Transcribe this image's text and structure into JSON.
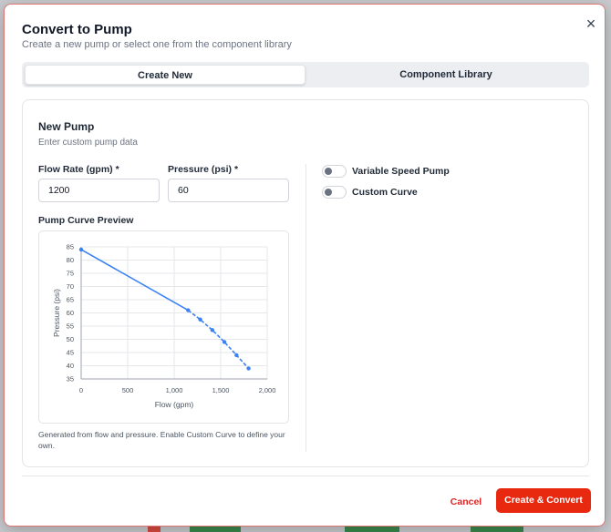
{
  "dialog": {
    "title": "Convert to Pump",
    "subtitle": "Create a new pump or select one from the component library",
    "close_icon": "close-icon",
    "close_glyph": "×"
  },
  "tabs": [
    {
      "label": "Create New",
      "active": true
    },
    {
      "label": "Component Library",
      "active": false
    }
  ],
  "new_pump": {
    "title": "New Pump",
    "description": "Enter custom pump data",
    "flow_rate": {
      "label": "Flow Rate (gpm) *",
      "value": "1200"
    },
    "pressure": {
      "label": "Pressure (psi) *",
      "value": "60"
    },
    "preview_title": "Pump Curve Preview",
    "note": "Generated from flow and pressure. Enable Custom Curve to define your own."
  },
  "options": [
    {
      "label": "Variable Speed Pump",
      "on": false
    },
    {
      "label": "Custom Curve",
      "on": false
    }
  ],
  "footer": {
    "cancel_label": "Cancel",
    "submit_label": "Create & Convert"
  },
  "colors": {
    "accent": "#e8280f",
    "cancel": "#dc2626",
    "curve": "#3b82f6"
  },
  "chart_data": {
    "type": "line",
    "xlabel": "Flow (gpm)",
    "ylabel": "Pressure (psi)",
    "xlim": [
      0,
      2000
    ],
    "ylim": [
      35,
      85
    ],
    "x_ticks": [
      "0",
      "500",
      "1,000",
      "1,500",
      "2,000"
    ],
    "y_ticks": [
      "35",
      "40",
      "45",
      "50",
      "55",
      "60",
      "65",
      "70",
      "75",
      "80",
      "85"
    ],
    "grid": true,
    "series": [
      {
        "x": [
          0,
          1150,
          1280,
          1410,
          1540,
          1670,
          1800
        ],
        "y": [
          84,
          61,
          57.5,
          53.5,
          49,
          44,
          39
        ]
      }
    ]
  }
}
